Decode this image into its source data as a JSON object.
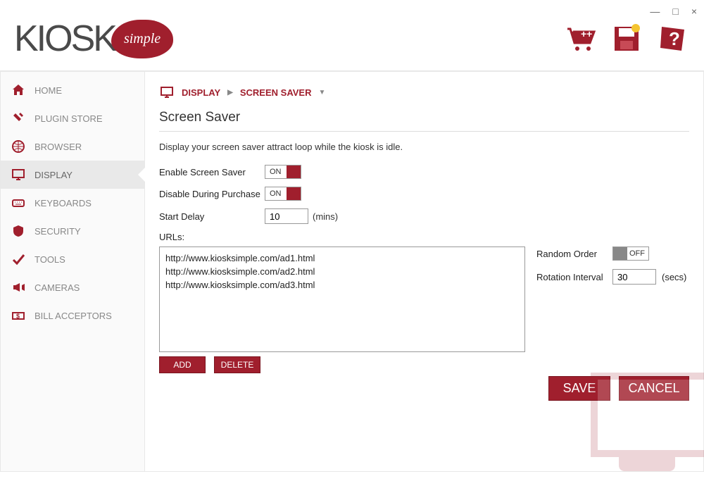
{
  "window_controls": {
    "min": "—",
    "max": "□",
    "close": "×"
  },
  "logo": {
    "text": "KIOSK",
    "bubble": "simple"
  },
  "sidebar": {
    "items": [
      {
        "label": "HOME",
        "icon": "home"
      },
      {
        "label": "PLUGIN STORE",
        "icon": "plug"
      },
      {
        "label": "BROWSER",
        "icon": "globe"
      },
      {
        "label": "DISPLAY",
        "icon": "monitor",
        "active": true
      },
      {
        "label": "KEYBOARDS",
        "icon": "keyboard"
      },
      {
        "label": "SECURITY",
        "icon": "shield"
      },
      {
        "label": "TOOLS",
        "icon": "check"
      },
      {
        "label": "CAMERAS",
        "icon": "camera"
      },
      {
        "label": "BILL ACCEPTORS",
        "icon": "bill"
      }
    ]
  },
  "breadcrumb": {
    "a": "DISPLAY",
    "b": "SCREEN SAVER"
  },
  "page": {
    "title": "Screen Saver",
    "description": "Display your screen saver attract loop while the kiosk is idle."
  },
  "form": {
    "enable_label": "Enable Screen Saver",
    "enable_value": "ON",
    "disable_label": "Disable During Purchase",
    "disable_value": "ON",
    "delay_label": "Start Delay",
    "delay_value": "10",
    "delay_unit": "(mins)",
    "urls_label": "URLs:",
    "urls": [
      "http://www.kiosksimple.com/ad1.html",
      "http://www.kiosksimple.com/ad2.html",
      "http://www.kiosksimple.com/ad3.html"
    ],
    "random_label": "Random Order",
    "random_value": "OFF",
    "rotation_label": "Rotation Interval",
    "rotation_value": "30",
    "rotation_unit": "(secs)",
    "add_btn": "ADD",
    "delete_btn": "DELETE",
    "save_btn": "SAVE",
    "cancel_btn": "CANCEL"
  }
}
